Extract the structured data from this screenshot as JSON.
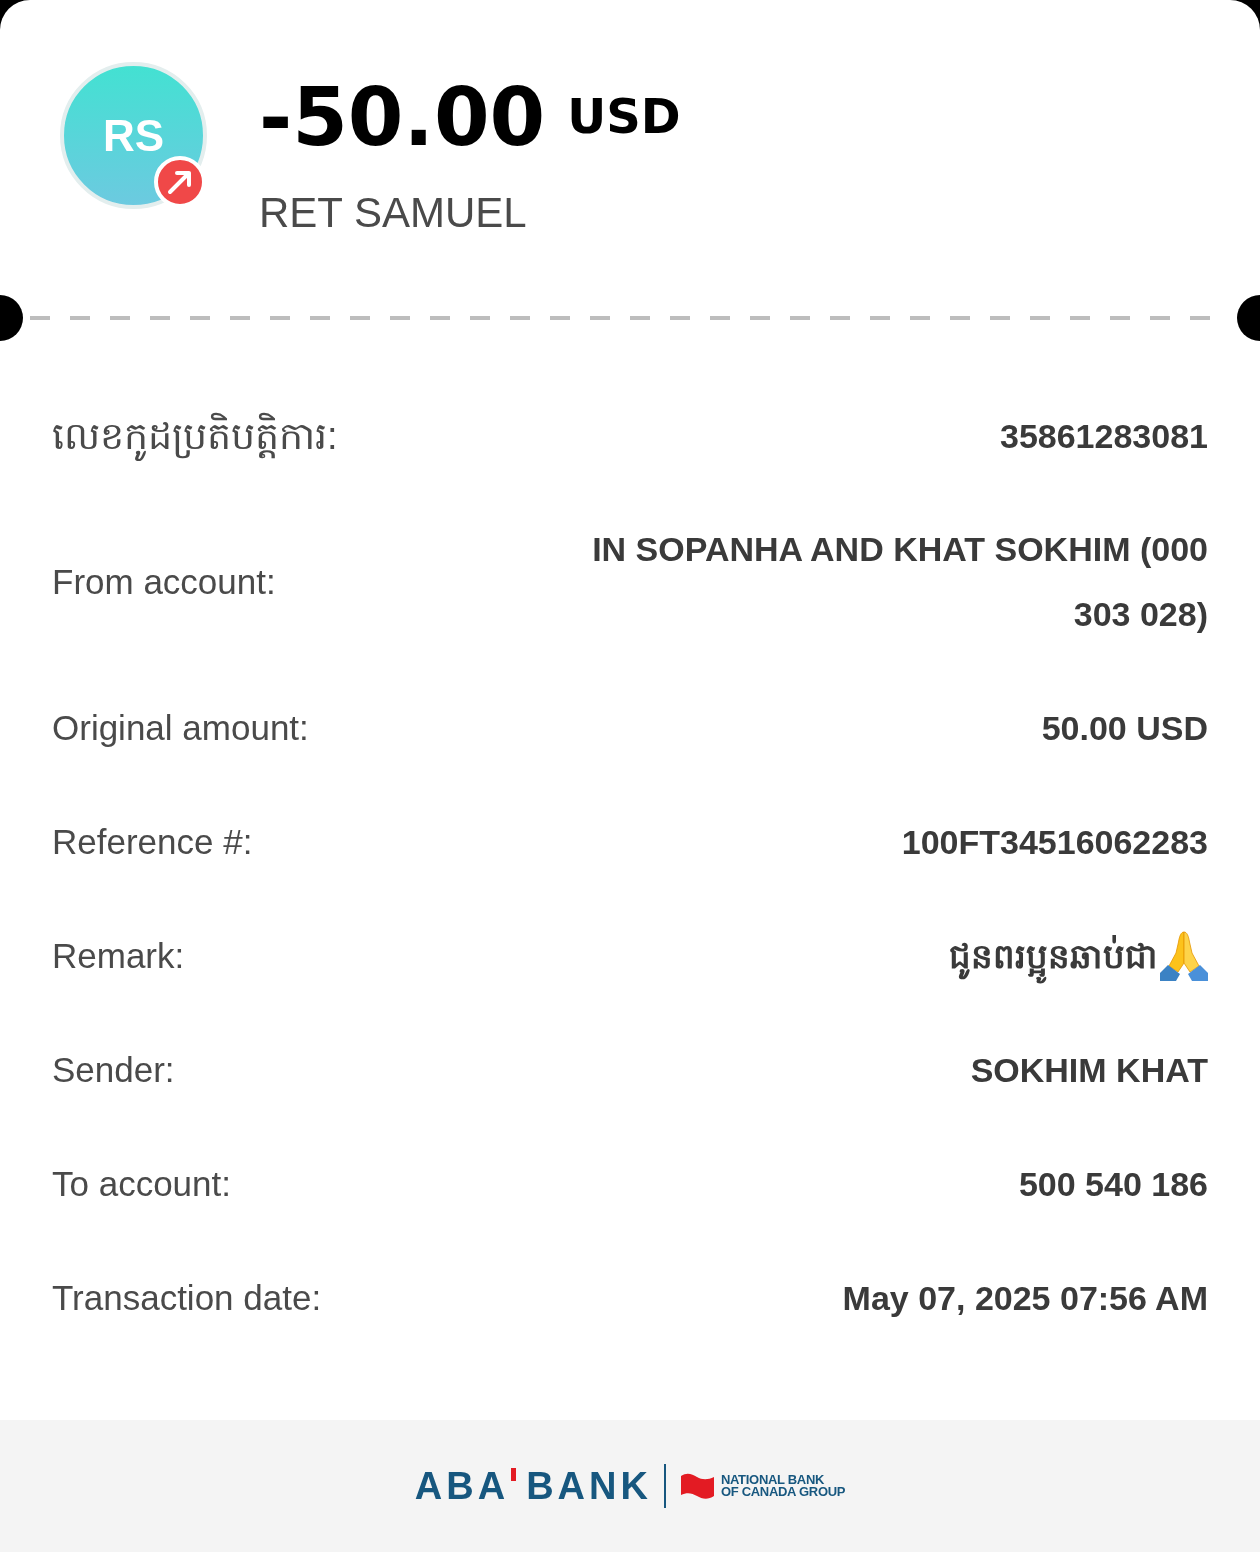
{
  "header": {
    "initials": "RS",
    "outgoing": true,
    "amount": "-50.00",
    "currency": "USD",
    "name": "RET SAMUEL"
  },
  "details": [
    {
      "kind": "text",
      "label": "លេខកូដប្រតិបត្តិការ:",
      "value": "35861283081"
    },
    {
      "kind": "text",
      "label": "From account:",
      "value": "IN SOPANHA AND KHAT SOKHIM (000 303 028)"
    },
    {
      "kind": "text",
      "label": "Original amount:",
      "value": "50.00 USD"
    },
    {
      "kind": "text",
      "label": "Reference #:",
      "value": "100FT34516062283"
    },
    {
      "kind": "remark",
      "label": "Remark:",
      "value": "ជូនពរប្អូនឆាប់ជា"
    },
    {
      "kind": "text",
      "label": "Sender:",
      "value": "SOKHIM KHAT"
    },
    {
      "kind": "text",
      "label": "To account:",
      "value": "500 540 186"
    },
    {
      "kind": "text",
      "label": "Transaction date:",
      "value": "May 07, 2025 07:56 AM"
    }
  ],
  "footer": {
    "brand": [
      "ABA",
      "BANK"
    ],
    "partner": [
      "NATIONAL BANK",
      "OF CANADA GROUP"
    ]
  }
}
